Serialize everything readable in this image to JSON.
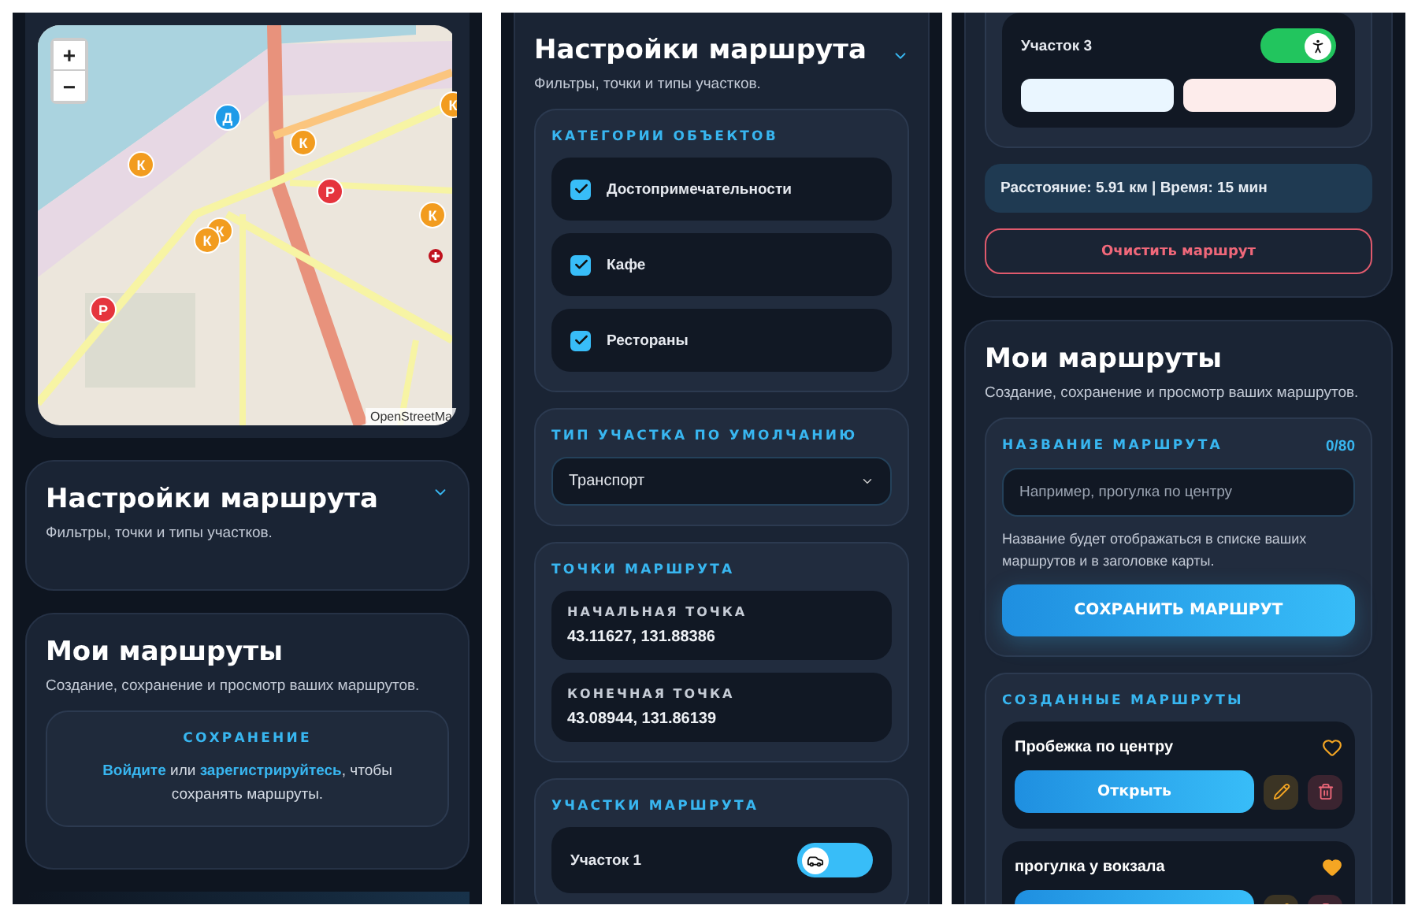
{
  "screen_1": {
    "map": {
      "zoom_in": "+",
      "zoom_out": "−",
      "attribution": "OpenStreetMa",
      "markers": [
        {
          "label": "Д",
          "color": "#1e9be8"
        },
        {
          "label": "К",
          "color": "#f29c1f"
        },
        {
          "label": "К",
          "color": "#f29c1f"
        },
        {
          "label": "К",
          "color": "#f29c1f"
        },
        {
          "label": "Р",
          "color": "#e5343d"
        },
        {
          "label": "К",
          "color": "#f29c1f"
        },
        {
          "label": "К",
          "color": "#f29c1f"
        },
        {
          "label": "К",
          "color": "#f29c1f"
        },
        {
          "label": "Р",
          "color": "#e5343d"
        }
      ]
    },
    "settings_card": {
      "title": "Настройки маршрута",
      "subtitle": "Фильтры, точки и типы участков."
    },
    "routes_card": {
      "title": "Мои маршруты",
      "subtitle": "Создание, сохранение и просмотр ваших маршрутов.",
      "notice": {
        "heading": "СОХРАНЕНИЕ",
        "login_link": "Войдите",
        "joiner": " или ",
        "register_link": "зарегистрируйтесь",
        "rest": ", чтобы сохранять маршруты."
      }
    }
  },
  "screen_2": {
    "title": "Настройки маршрута",
    "subtitle": "Фильтры, точки и типы участков.",
    "categories": {
      "heading": "КАТЕГОРИИ ОБЪЕКТОВ",
      "items": [
        {
          "label": "Достопримечательности",
          "checked": true
        },
        {
          "label": "Кафе",
          "checked": true
        },
        {
          "label": "Рестораны",
          "checked": true
        }
      ]
    },
    "default_segment_type": {
      "heading": "ТИП УЧАСТКА ПО УМОЛЧАНИЮ",
      "value": "Транспорт"
    },
    "points": {
      "heading": "ТОЧКИ МАРШРУТА",
      "items": [
        {
          "label": "НАЧАЛЬНАЯ ТОЧКА",
          "value": "43.11627, 131.88386"
        },
        {
          "label": "КОНЕЧНАЯ ТОЧКА",
          "value": "43.08944, 131.86139"
        }
      ]
    },
    "segments": {
      "heading": "УЧАСТКИ МАРШРУТА",
      "items": [
        {
          "label": "Участок 1",
          "kind": "transport"
        }
      ]
    }
  },
  "screen_3": {
    "segments": [
      {
        "label": "Участок 3",
        "kind": "walk"
      }
    ],
    "summary": "Расстояние: 5.91 км | Время: 15 мин",
    "clear_button": "Очистить маршрут",
    "routes_card": {
      "title": "Мои маршруты",
      "subtitle": "Создание, сохранение и просмотр ваших маршрутов.",
      "name_section": {
        "heading": "НАЗВАНИЕ МАРШРУТА",
        "counter": "0/80",
        "placeholder": "Например, прогулка по центру",
        "hint": "Название будет отображаться в списке ваших маршрутов и в заголовке карты.",
        "save_button": "СОХРАНИТЬ МАРШРУТ"
      },
      "created": {
        "heading": "СОЗДАННЫЕ МАРШРУТЫ",
        "routes": [
          {
            "name": "Пробежка по центру",
            "favorite": false,
            "open_button": "Открыть"
          },
          {
            "name": "прогулка у вокзала",
            "favorite": true
          }
        ]
      }
    }
  }
}
